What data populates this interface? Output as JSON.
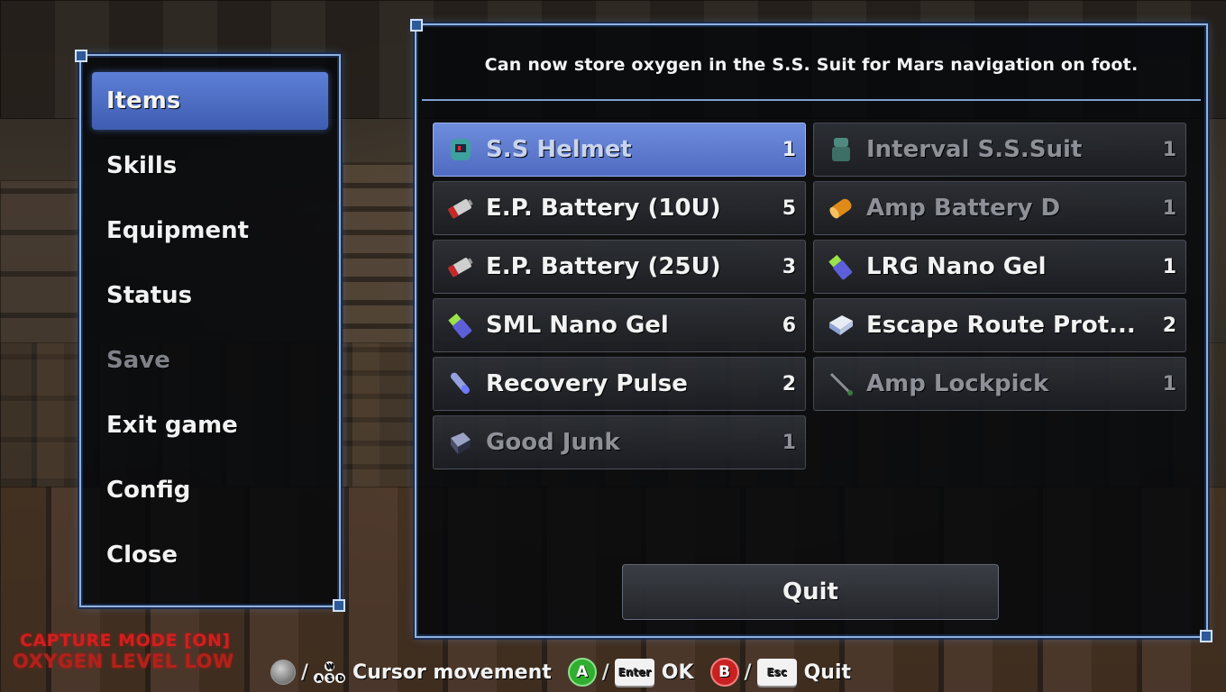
{
  "menu": {
    "items": [
      {
        "label": "Items",
        "state": "active"
      },
      {
        "label": "Skills",
        "state": "normal"
      },
      {
        "label": "Equipment",
        "state": "normal"
      },
      {
        "label": "Status",
        "state": "normal"
      },
      {
        "label": "Save",
        "state": "disabled"
      },
      {
        "label": "Exit game",
        "state": "normal"
      },
      {
        "label": "Config",
        "state": "normal"
      },
      {
        "label": "Close",
        "state": "normal"
      }
    ]
  },
  "description": "Can now store oxygen in the S.S. Suit for Mars navigation on foot.",
  "items": [
    {
      "name": "S.S Helmet",
      "qty": "1",
      "icon": "helmet-icon",
      "state": "selected"
    },
    {
      "name": "Interval S.S.Suit",
      "qty": "1",
      "icon": "suit-icon",
      "state": "dim"
    },
    {
      "name": "E.P. Battery (10U)",
      "qty": "5",
      "icon": "battery-icon",
      "state": "normal"
    },
    {
      "name": "Amp Battery D",
      "qty": "1",
      "icon": "amp-battery-icon",
      "state": "dim"
    },
    {
      "name": "E.P. Battery (25U)",
      "qty": "3",
      "icon": "battery-icon",
      "state": "normal"
    },
    {
      "name": "LRG Nano Gel",
      "qty": "1",
      "icon": "nano-gel-icon",
      "state": "normal"
    },
    {
      "name": "SML Nano Gel",
      "qty": "6",
      "icon": "nano-gel-icon",
      "state": "normal"
    },
    {
      "name": "Escape Route Prot...",
      "qty": "2",
      "icon": "book-icon",
      "state": "normal"
    },
    {
      "name": "Recovery Pulse",
      "qty": "2",
      "icon": "vial-icon",
      "state": "normal"
    },
    {
      "name": "Amp Lockpick",
      "qty": "1",
      "icon": "lockpick-icon",
      "state": "dim"
    },
    {
      "name": "Good Junk",
      "qty": "1",
      "icon": "junk-icon",
      "state": "dim"
    }
  ],
  "quit_button": "Quit",
  "capture": {
    "mode": "CAPTURE MODE [ON]",
    "oxygen": "OXYGEN LEVEL LOW"
  },
  "controls": {
    "wasd_keys": [
      "W",
      "A",
      "S",
      "D"
    ],
    "a_button": "A",
    "enter_key": "Enter",
    "b_button": "B",
    "esc_key": "Esc",
    "slash": "/",
    "cursor_label": "Cursor movement",
    "ok_label": "OK",
    "quit_label": "Quit"
  },
  "colors": {
    "accent": "#5d7fd6",
    "frame": "#8fb2e0",
    "warning": "#d11f1f"
  }
}
